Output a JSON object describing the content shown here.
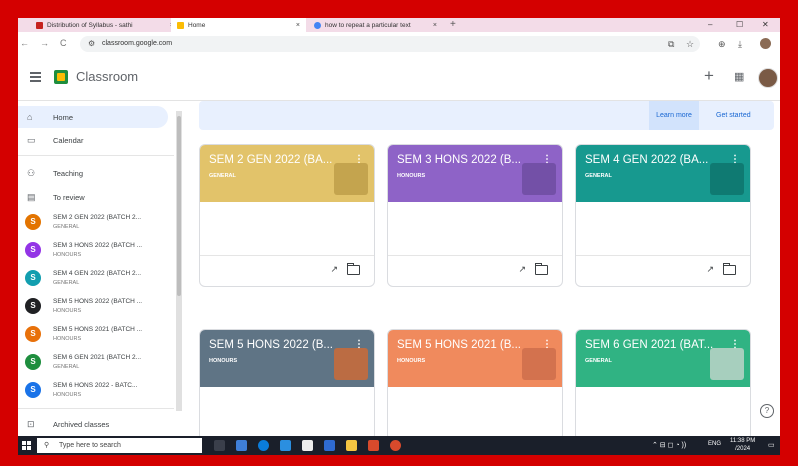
{
  "browser": {
    "tabs": [
      {
        "label": "Distribution of Syllabus - sathi",
        "close": "×",
        "icon_color": "#c5221f"
      },
      {
        "label": "Home",
        "close": "×",
        "icon_color": "#fbbc04"
      },
      {
        "label": "how to repeat a particular text",
        "close": "×",
        "icon_color": "#4285f4"
      }
    ],
    "new_tab": "+",
    "window_controls": {
      "minimize": "–",
      "maximize": "☐",
      "close": "✕"
    },
    "url": "classroom.google.com"
  },
  "header": {
    "app_name": "Classroom",
    "create": "+",
    "apps": "⋮⋮⋮"
  },
  "sidebar": {
    "home": "Home",
    "calendar": "Calendar",
    "teaching": "Teaching",
    "to_review": "To review",
    "classes": [
      {
        "name": "SEM 2 GEN 2022 (BATCH 2...",
        "section": "GENERAL",
        "initial": "S",
        "color": "#e37400"
      },
      {
        "name": "SEM 3 HONS 2022 (BATCH ...",
        "section": "HONOURS",
        "initial": "S",
        "color": "#9334e6"
      },
      {
        "name": "SEM 4 GEN 2022 (BATCH 2...",
        "section": "GENERAL",
        "initial": "S",
        "color": "#129eaf"
      },
      {
        "name": "SEM 5 HONS 2022 (BATCH ...",
        "section": "HONOURS",
        "initial": "S",
        "color": "#202124"
      },
      {
        "name": "SEM 5 HONS 2021 (BATCH ...",
        "section": "HONOURS",
        "initial": "S",
        "color": "#e8710a"
      },
      {
        "name": "SEM 6 GEN 2021 (BATCH 2...",
        "section": "GENERAL",
        "initial": "S",
        "color": "#1e8e3e"
      },
      {
        "name": "SEM 6 HONS 2022 - BATC...",
        "section": "HONOURS",
        "initial": "S",
        "color": "#1a73e8"
      }
    ],
    "archived": "Archived classes"
  },
  "banner": {
    "learn_more": "Learn more",
    "get_started": "Get started"
  },
  "cards": [
    {
      "title": "SEM 2 GEN 2022 (BA...",
      "section": "GENERAL",
      "color": "#e2c36a"
    },
    {
      "title": "SEM 3 HONS 2022 (B...",
      "section": "HONOURS",
      "color": "#8e63c7"
    },
    {
      "title": "SEM 4 GEN 2022 (BA...",
      "section": "GENERAL",
      "color": "#17998f"
    },
    {
      "title": "SEM 5 HONS 2022 (B...",
      "section": "HONOURS",
      "color": "#5f7485"
    },
    {
      "title": "SEM 5 HONS 2021 (B...",
      "section": "HONOURS",
      "color": "#f08a5d"
    },
    {
      "title": "SEM 6 GEN 2021 (BAT...",
      "section": "GENERAL",
      "color": "#30b383"
    }
  ],
  "taskbar": {
    "search_placeholder": "Type here to search",
    "lang": "ENG",
    "time": "11:38 PM",
    "date": "/2024"
  }
}
